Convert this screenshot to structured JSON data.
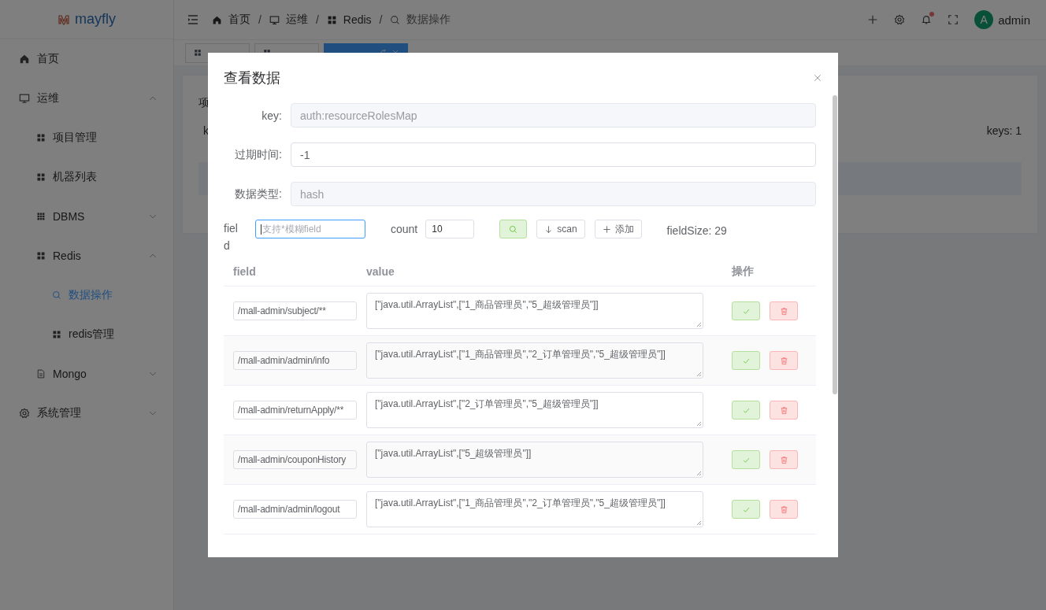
{
  "sidebar": {
    "logo": "mayfly",
    "items": [
      {
        "label": "首页",
        "kind": "home",
        "selected": false
      },
      {
        "label": "运维",
        "kind": "monitor",
        "selected": false,
        "expanded": true,
        "children": [
          {
            "label": "项目管理",
            "kind": "grid",
            "selected": false
          },
          {
            "label": "机器列表",
            "kind": "grid",
            "selected": false
          },
          {
            "label": "DBMS",
            "kind": "grid9",
            "selected": false,
            "expanded": false
          },
          {
            "label": "Redis",
            "kind": "grid",
            "selected": false,
            "expanded": true,
            "children": [
              {
                "label": "数据操作",
                "kind": "search",
                "selected": true
              },
              {
                "label": "redis管理",
                "kind": "grid",
                "selected": false
              }
            ]
          },
          {
            "label": "Mongo",
            "kind": "doc",
            "selected": false,
            "expanded": false
          }
        ]
      },
      {
        "label": "系统管理",
        "kind": "gear",
        "selected": false,
        "expanded": false
      }
    ]
  },
  "header": {
    "breadcrumb": [
      {
        "label": "首页",
        "kind": "home",
        "separator": "/"
      },
      {
        "label": "运维",
        "kind": "monitor",
        "separator": "/"
      },
      {
        "label": "Redis",
        "kind": "grid",
        "separator": "/"
      },
      {
        "label": "数据操作",
        "kind": "search"
      }
    ],
    "has_unread": true,
    "user": {
      "avatar": "A",
      "name": "admin"
    }
  },
  "tabs": [
    {
      "selected": false
    },
    {
      "selected": false
    },
    {
      "selected": true
    }
  ],
  "card": {
    "text_1": "项",
    "text_2": "k",
    "keys": "keys: 1"
  },
  "modal": {
    "title": "查看数据",
    "form": [
      {
        "label": "key:",
        "value": "auth:resourceRolesMap",
        "disabled": true
      },
      {
        "label": "过期时间:",
        "value": "-1",
        "disabled": false
      },
      {
        "label": "数据类型:",
        "value": "hash",
        "disabled": true
      }
    ],
    "filter": {
      "label": "field",
      "placeholder": "支持*模糊field",
      "focused": true,
      "count_label": "count",
      "count": "10",
      "scan": "scan",
      "add": "添加",
      "field_size": "fieldSize: 29"
    },
    "table": {
      "columns": [
        "field",
        "value",
        "操作"
      ],
      "rows": [
        {
          "field": "/mall-admin/subject/**",
          "value": "[\"java.util.ArrayList\",[\"1_商品管理员\",\"5_超级管理员\"]]"
        },
        {
          "field": "/mall-admin/admin/info",
          "value": "[\"java.util.ArrayList\",[\"1_商品管理员\",\"2_订单管理员\",\"5_超级管理员\"]]"
        },
        {
          "field": "/mall-admin/returnApply/**",
          "value": "[\"java.util.ArrayList\",[\"2_订单管理员\",\"5_超级管理员\"]]"
        },
        {
          "field": "/mall-admin/couponHistory",
          "value": "[\"java.util.ArrayList\",[\"5_超级管理员\"]]"
        },
        {
          "field": "/mall-admin/admin/logout",
          "value": "[\"java.util.ArrayList\",[\"1_商品管理员\",\"2_订单管理员\",\"5_超级管理员\"]]"
        }
      ]
    }
  }
}
